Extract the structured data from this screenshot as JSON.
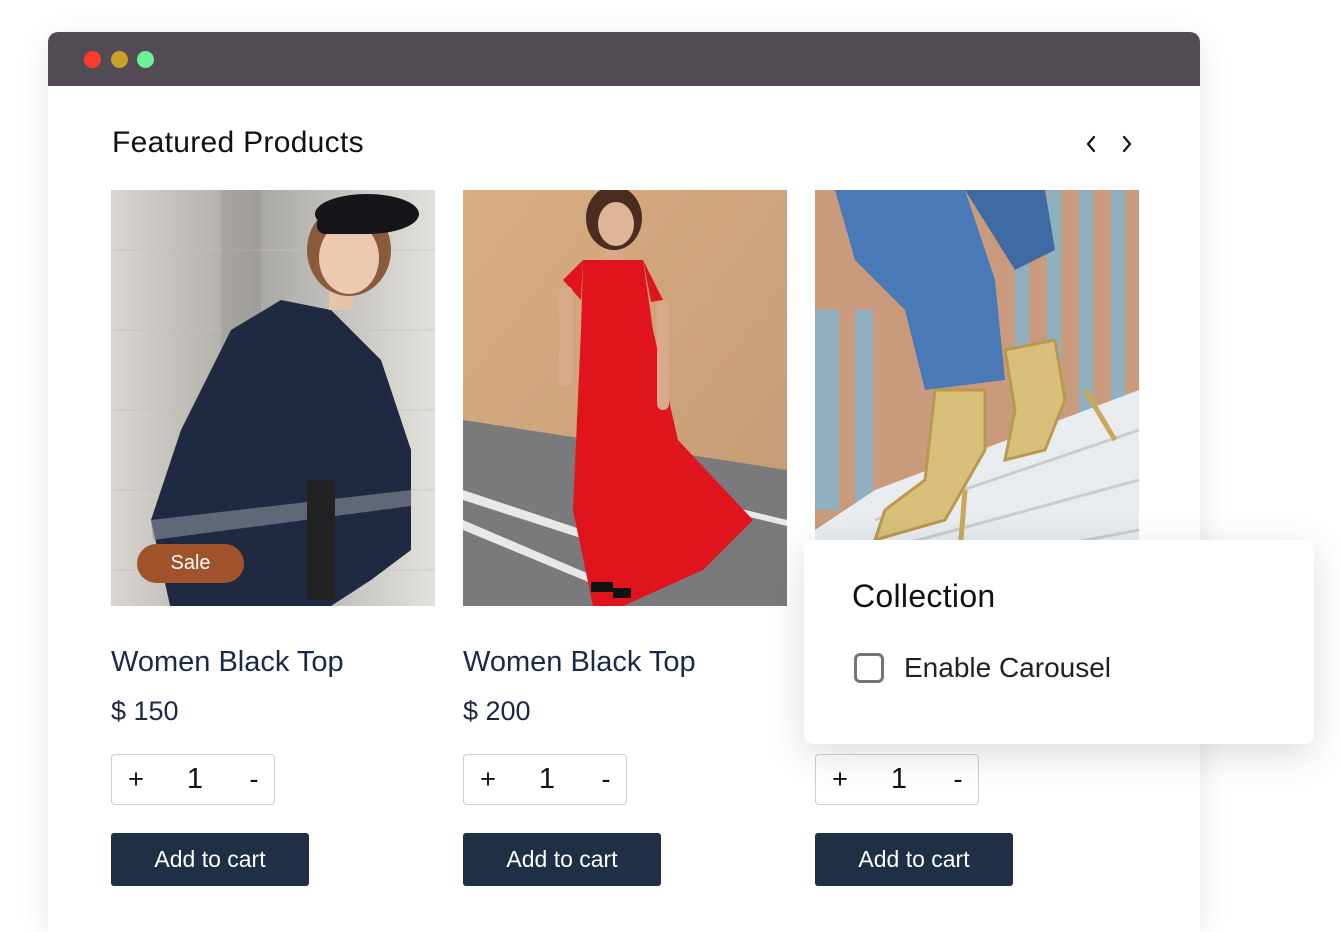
{
  "section": {
    "title": "Featured Products",
    "prev_icon": "chevron-left-icon",
    "next_icon": "chevron-right-icon"
  },
  "products": [
    {
      "name": "Women Black Top",
      "price": "$ 150",
      "quantity": "1",
      "plus": "+",
      "minus": "-",
      "cta": "Add to cart",
      "badge": "Sale",
      "image": "woman-in-navy-poncho-and-beret"
    },
    {
      "name": "Women Black Top",
      "price": "$ 200",
      "quantity": "1",
      "plus": "+",
      "minus": "-",
      "cta": "Add to cart",
      "image": "woman-in-red-maxi-dress-on-road"
    },
    {
      "quantity": "1",
      "plus": "+",
      "minus": "-",
      "cta": "Add to cart",
      "image": "gold-strappy-heels-and-jeans-on-steps"
    }
  ],
  "collection_panel": {
    "title": "Collection",
    "checkbox_label": "Enable Carousel",
    "checked": false
  },
  "colors": {
    "titlebar": "#524b53",
    "primary_button": "#1e2f46",
    "sale_badge": "#a0532a",
    "text_navy": "#1b2a44"
  }
}
